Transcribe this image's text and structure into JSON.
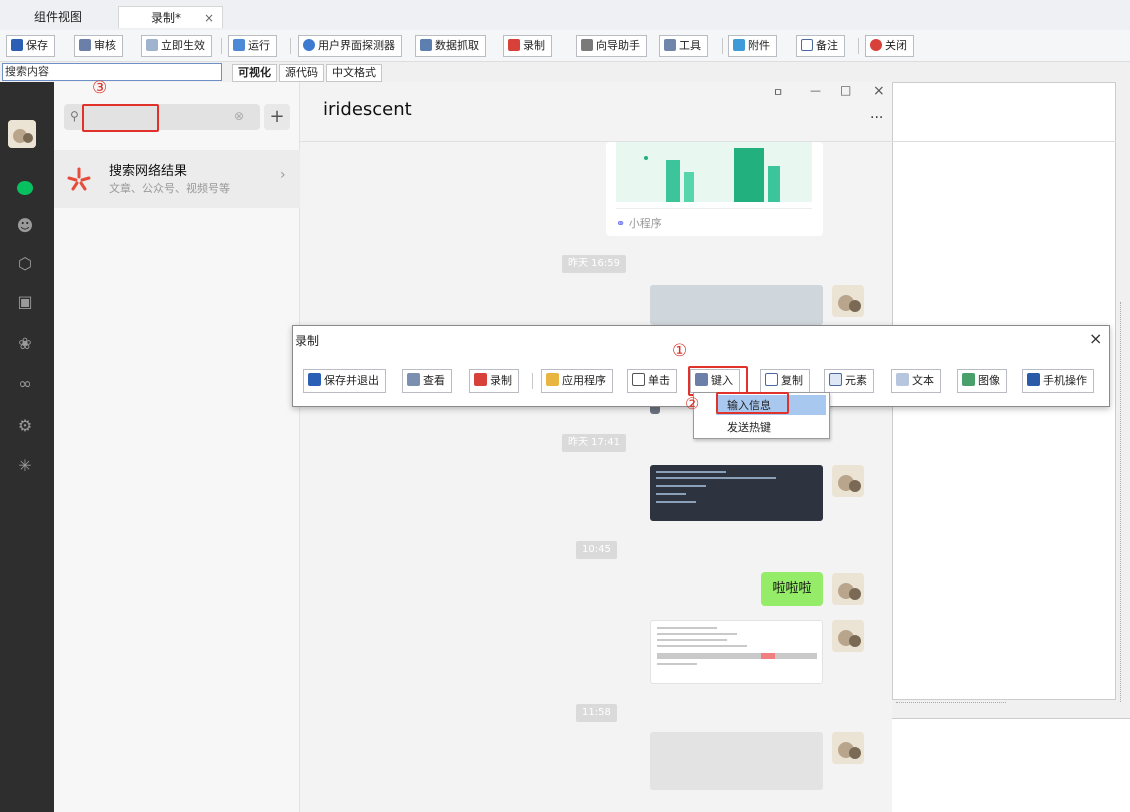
{
  "tabs": {
    "tab1": "组件视图",
    "tab2": "录制*",
    "tab2_close": "×"
  },
  "toolbar": {
    "save": "保存",
    "review": "审核",
    "apply_now": "立即生效",
    "run": "运行",
    "ui_detector": "用户界面探测器",
    "data_capture": "数据抓取",
    "record": "录制",
    "wizard": "向导助手",
    "tools": "工具",
    "attachment": "附件",
    "notes": "备注",
    "close": "关闭"
  },
  "search_row": {
    "search_label": "搜索内容",
    "tab_visual": "可视化",
    "tab_source": "源代码",
    "tab_chinese": "中文格式"
  },
  "wechat": {
    "search_result_title": "搜索网络结果",
    "search_result_sub": "文章、公众号、视频号等",
    "chat_name": "iridescent",
    "more": "...",
    "mini_program": "小程序",
    "times": [
      "昨天 16:59",
      "昨天 17:41",
      "10:45",
      "11:58"
    ],
    "bubble_text": "啦啦啦"
  },
  "dialog": {
    "title": "录制",
    "close": "×",
    "buttons": {
      "save_exit": "保存并退出",
      "view": "查看",
      "record": "录制",
      "app": "应用程序",
      "click": "单击",
      "type": "键入",
      "copy": "复制",
      "element": "元素",
      "text": "文本",
      "image": "图像",
      "mobile": "手机操作"
    }
  },
  "menu": {
    "input_info": "输入信息",
    "send_hotkey": "发送热键"
  },
  "annotations": {
    "n1": "①",
    "n2": "②",
    "n3": "③"
  },
  "window_controls": {
    "pin": "ㅁ",
    "min": "—",
    "max": "□",
    "close": "×"
  }
}
